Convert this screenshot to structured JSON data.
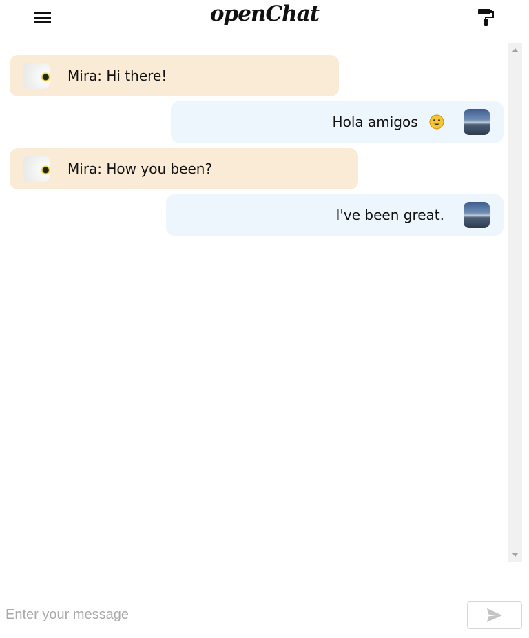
{
  "header": {
    "title": "openChat",
    "menu_icon": "hamburger-menu-icon",
    "paint_icon": "paint-roller-icon"
  },
  "messages": [
    {
      "direction": "incoming",
      "text": "Mira: Hi there!",
      "avatar": "daisy-avatar"
    },
    {
      "direction": "outgoing",
      "text": "Hola amigos",
      "emoji": "grinning-face",
      "avatar": "sky-avatar"
    },
    {
      "direction": "incoming",
      "text": "Mira: How you been?",
      "avatar": "daisy-avatar"
    },
    {
      "direction": "outgoing",
      "text": "I've been great.",
      "avatar": "sky-avatar"
    }
  ],
  "composer": {
    "placeholder": "Enter your message",
    "value": "",
    "send_icon": "send-icon"
  },
  "colors": {
    "incoming_bubble": "#faebd7",
    "outgoing_bubble": "#eef6fd",
    "scrollbar_track": "#f1f1f1"
  }
}
